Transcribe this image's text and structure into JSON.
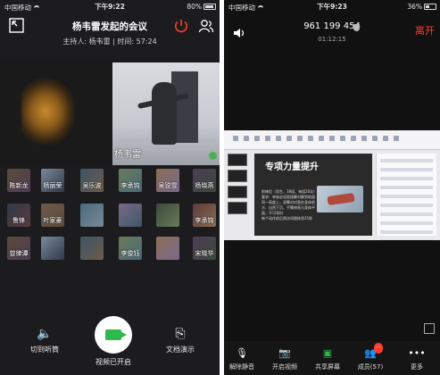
{
  "left": {
    "status": {
      "carrier": "中国移动",
      "time": "下午9:22",
      "battery": "80%"
    },
    "header": {
      "title": "杨韦雷发起的会议",
      "host_line": "主持人: 杨韦雷 | 时间: 57:24"
    },
    "speaker": {
      "name": "杨韦雷"
    },
    "participants": [
      [
        "陈新龙",
        "杨丽荣",
        "吴乐波",
        "李承钩",
        "吴锐雪",
        "杨晓燕"
      ],
      [
        "鲁锋",
        "叶家豪",
        "",
        "",
        "",
        "李承钩"
      ],
      [
        "曾律谭",
        "",
        "",
        "李俊钰",
        "",
        "宋晓华"
      ]
    ],
    "controls": {
      "audio": "切到听筒",
      "video": "视频已开启",
      "doc": "文档演示"
    },
    "colors": {
      "accent_red": "#e63b2e",
      "green": "#2fb94c"
    }
  },
  "right": {
    "status": {
      "carrier": "中国移动",
      "time": "下午9:23",
      "battery": "36%"
    },
    "header": {
      "number": "961 199 454",
      "timer": "01:12:15",
      "leave": "离开"
    },
    "slide": {
      "title": "专项力量提升",
      "body": [
        "前锋型（男生、38组、每组20次）",
        "要求：单体必须直接脚对脚到地面同一高度上，双臂对对直在身体前方、自然下沉、手臂伸直与身体平面，不可弯肘",
        "每个动作前后两次间隔休息25秒"
      ]
    },
    "toolbar": [
      {
        "label": "解除静音",
        "icon": "mic-muted-icon"
      },
      {
        "label": "开启视频",
        "icon": "video-off-icon"
      },
      {
        "label": "共享屏幕",
        "icon": "share-screen-icon"
      },
      {
        "label": "成员(57)",
        "icon": "members-icon",
        "badge": "···"
      },
      {
        "label": "更多",
        "icon": "more-icon"
      }
    ]
  }
}
